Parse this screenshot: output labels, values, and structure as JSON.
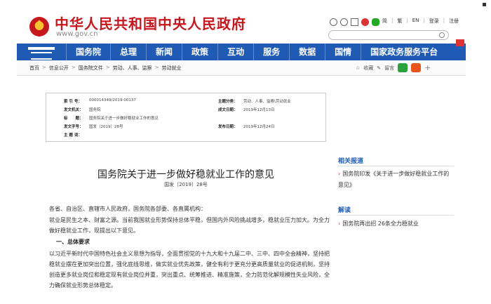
{
  "header": {
    "site_title": "中华人民共和国中央人民政府",
    "site_url": "www.gov.cn",
    "lang_links": [
      "简",
      "繁",
      "EN",
      "登录",
      "注册"
    ]
  },
  "nav": {
    "items": [
      "国务院",
      "总理",
      "新闻",
      "政策",
      "互动",
      "服务",
      "数据",
      "国情",
      "国家政务服务平台"
    ]
  },
  "breadcrumb": {
    "items": [
      "首页",
      "信息公开",
      "国务院文件",
      "劳动、人事、监察",
      "劳动就业"
    ],
    "tools": {
      "collect": "收藏",
      "comment": "留言"
    }
  },
  "info": {
    "rows": [
      {
        "k": "索 引 号：",
        "v": "000014349/2019-00137"
      },
      {
        "k": "发文机关：",
        "v": "国务院"
      },
      {
        "k": "标　　题：",
        "v": "国务院关于进一步做好稳就业工作的意见"
      },
      {
        "k": "发文字号：",
        "v": "国发〔2019〕28号"
      },
      {
        "k": "主 题 词：",
        "v": ""
      }
    ],
    "right_rows": [
      {
        "k": "主题分类：",
        "v": "劳动、人事、监察\\劳动就业"
      },
      {
        "k": "成文日期：",
        "v": "2019年12月13日"
      },
      {
        "k": "发布日期：",
        "v": "2019年12月24日"
      }
    ]
  },
  "article": {
    "title": "国务院关于进一步做好稳就业工作的意见",
    "doc_number": "国发〔2019〕28号",
    "salutation": "各省、自治区、直辖市人民政府，国务院各部委、各直属机构：",
    "p1": "就业是民生之本、财富之源。当前我国就业形势保持总体平稳，但国内外风险挑战增多，稳就业压力加大。为全力做好稳就业工作，现提出以下意见。",
    "section_head": "一、总体要求",
    "p2": "以习近平新时代中国特色社会主义思想为指导，全面贯彻党的十九大和十九届二中、三中、四中全会精神，坚持把稳就业摆在更加突出位置，强化底线思维，做实就业优先政策，健全有利于更充分更高质量就业的促进机制，坚持创造更多就业岗位和稳定现有就业岗位并重，突出重点、统筹推进、精准施策，全力防范化解规模性失业风险，全力确保就业形势总体稳定。"
  },
  "sidebar": {
    "related_title": "相关报道",
    "related_item": "国务院印发《关于进一步做好稳就业工作的意见》",
    "interpret_title": "解读",
    "interpret_item": "国务院再出招 26条全力稳就业"
  }
}
